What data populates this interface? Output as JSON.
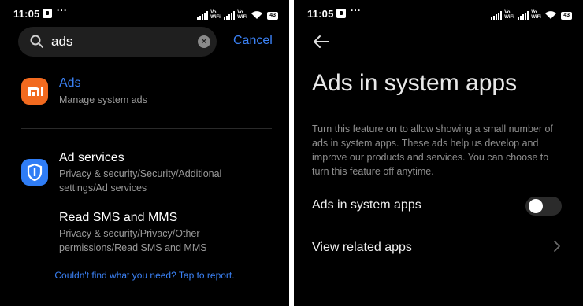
{
  "left": {
    "status": {
      "time": "11:05",
      "battery": "43",
      "vowifi": "Vo\nWiFi"
    },
    "search": {
      "query": "ads",
      "cancel_label": "Cancel"
    },
    "results": [
      {
        "title": "Ads",
        "subtitle": "Manage system ads",
        "icon": "mi-icon",
        "highlight": true
      },
      {
        "title": "Ad services",
        "subtitle": "Privacy & security/Security/Additional settings/Ad services",
        "icon": "shield-icon",
        "highlight": false
      },
      {
        "title": "Read SMS and MMS",
        "subtitle": "Privacy & security/Privacy/Other permissions/Read SMS and MMS",
        "icon": "",
        "highlight": false
      }
    ],
    "report_text": "Couldn't find what you need? Tap to report."
  },
  "right": {
    "status": {
      "time": "11:05",
      "battery": "43"
    },
    "title": "Ads in system apps",
    "description": "Turn this feature on to allow showing a small number of ads in system apps. These ads help us develop and improve our products and services. You can choose to turn this feature off anytime.",
    "toggle_row": {
      "label": "Ads in system apps",
      "enabled": false
    },
    "link_row": {
      "label": "View related apps"
    }
  },
  "colors": {
    "accent": "#3b82f6",
    "mi_orange": "#f26a1f",
    "shield_blue": "#2f7df6",
    "background": "#000000"
  }
}
